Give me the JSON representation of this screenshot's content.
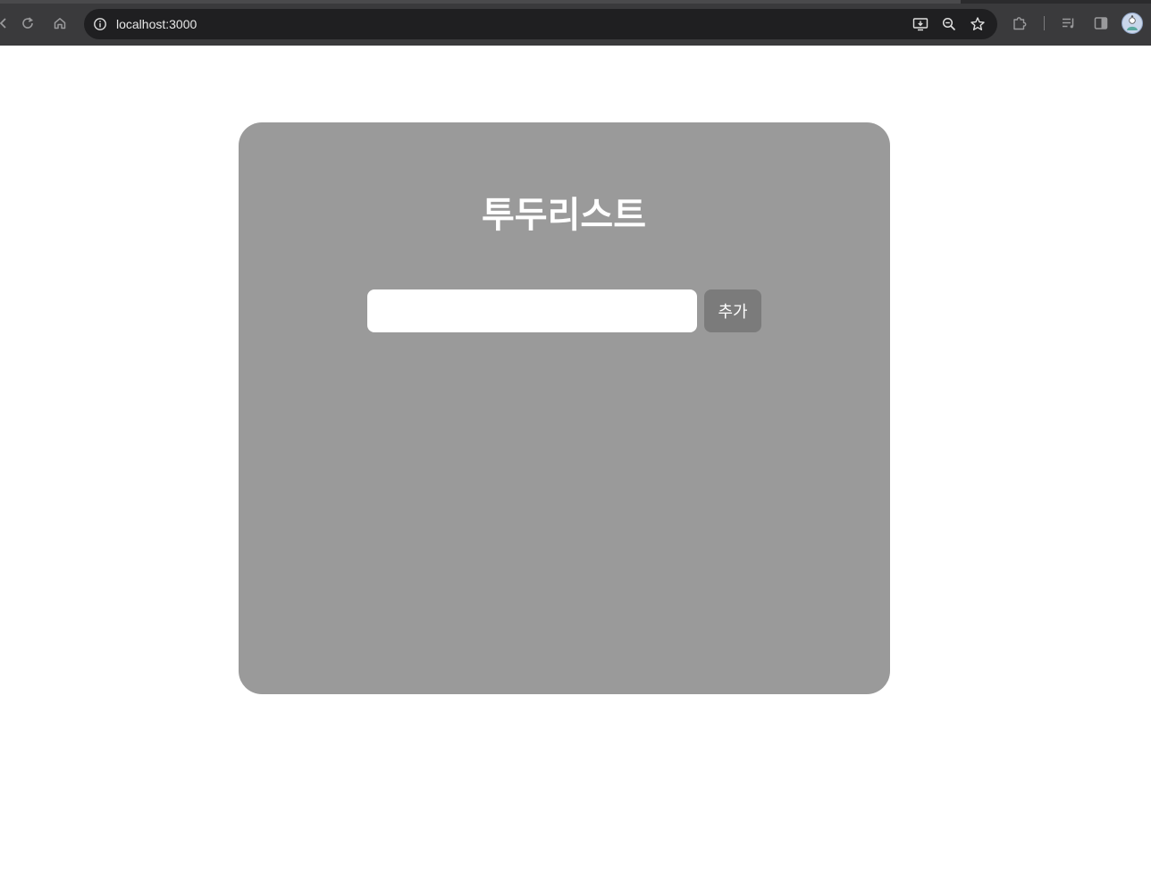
{
  "browser": {
    "url": "localhost:3000",
    "icons": {
      "back": "back-arrow-icon",
      "reload": "reload-icon",
      "home": "home-icon",
      "site_info": "info-icon",
      "install": "install-app-icon",
      "zoom": "zoom-out-icon",
      "bookmark": "star-icon",
      "extensions": "puzzle-icon",
      "reading_list": "reading-list-icon",
      "side_panel": "side-panel-icon",
      "profile": "avatar"
    },
    "colors": {
      "chrome_bg": "#3a3a3c",
      "omnibox_bg": "#1f1f21"
    }
  },
  "app": {
    "title": "투두리스트",
    "input": {
      "value": "",
      "placeholder": ""
    },
    "add_button_label": "추가",
    "colors": {
      "card_bg": "#9a9a9a",
      "button_bg": "#7b7b7b",
      "text": "#ffffff"
    }
  }
}
